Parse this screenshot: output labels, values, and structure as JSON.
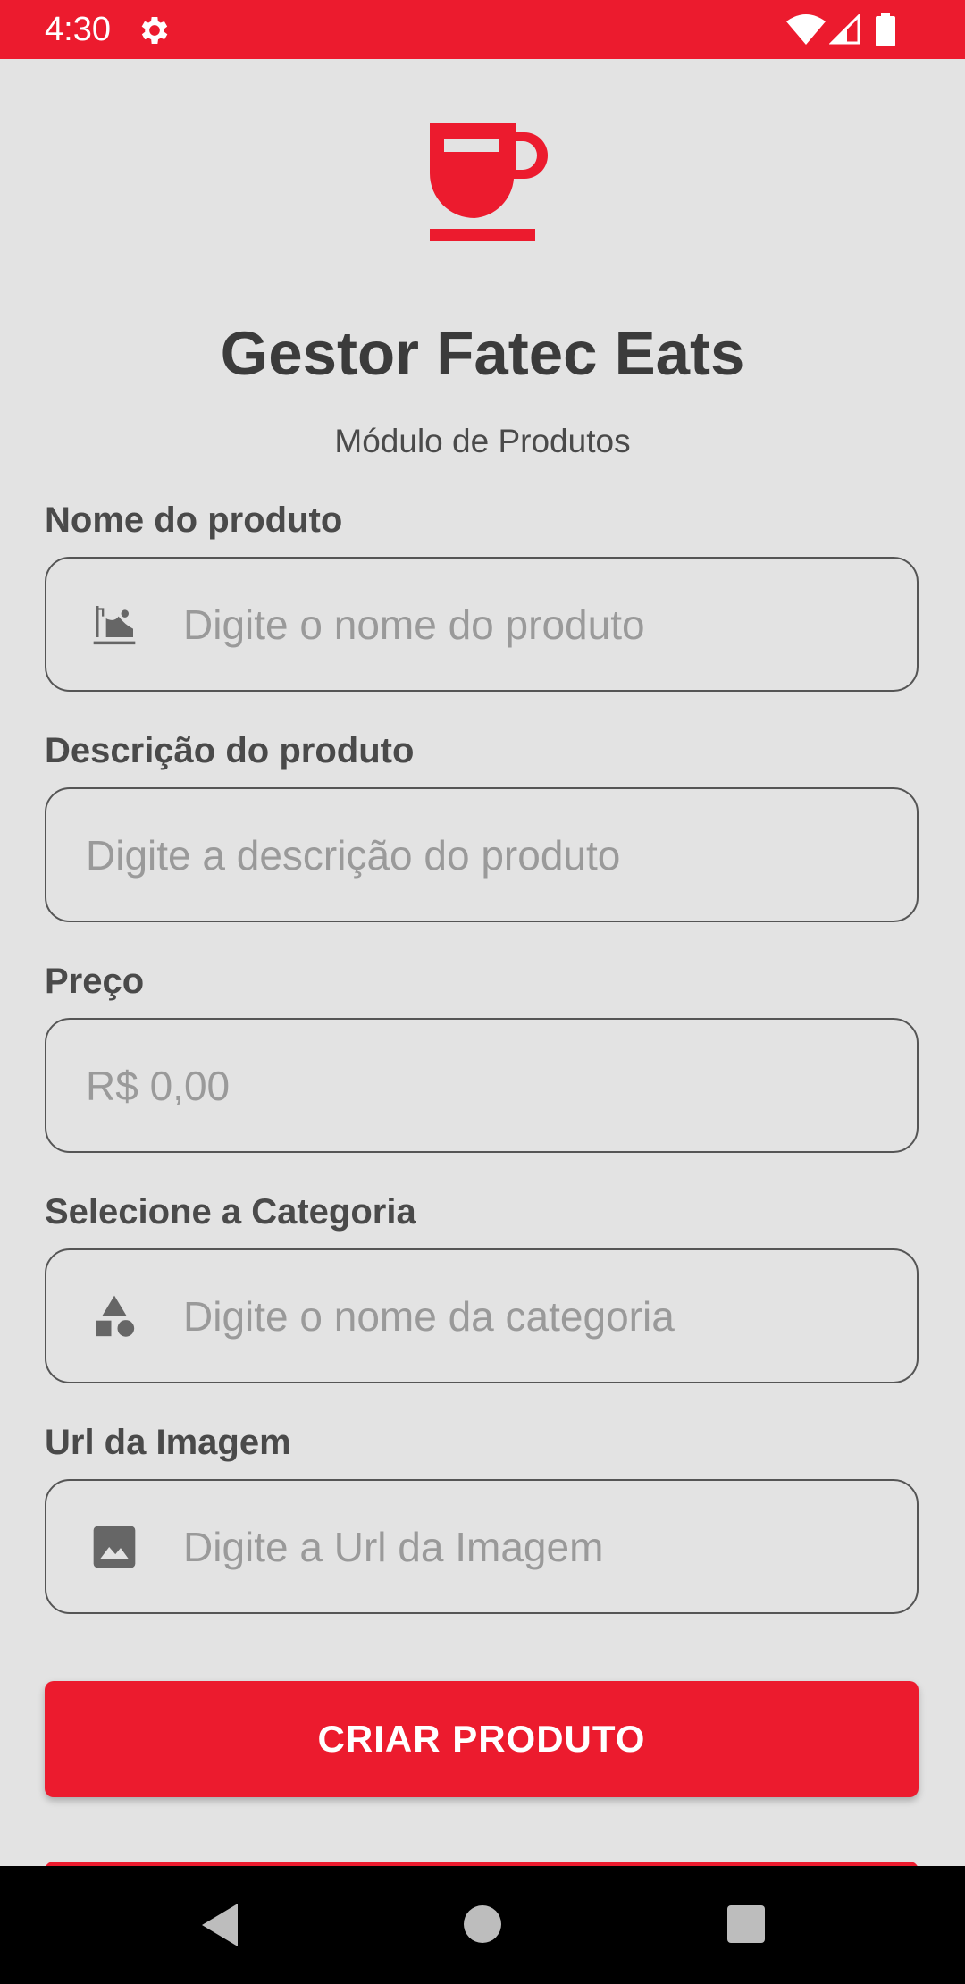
{
  "status_bar": {
    "time": "4:30",
    "icons": [
      "gear-icon",
      "wifi-icon",
      "signal-icon",
      "battery-icon"
    ]
  },
  "header": {
    "logo_icon": "coffee-cup-icon",
    "title": "Gestor Fatec Eats",
    "subtitle": "Módulo de Produtos"
  },
  "form": {
    "product_name": {
      "label": "Nome do produto",
      "placeholder": "Digite o nome do produto",
      "icon": "food-tray-icon"
    },
    "description": {
      "label": "Descrição do produto",
      "placeholder": "Digite a descrição do produto"
    },
    "price": {
      "label": "Preço",
      "placeholder": "R$ 0,00"
    },
    "category": {
      "label": "Selecione a Categoria",
      "placeholder": "Digite o nome da categoria",
      "icon": "category-shapes-icon"
    },
    "image_url": {
      "label": "Url da Imagem",
      "placeholder": "Digite a Url da Imagem",
      "icon": "image-icon"
    },
    "submit_label": "CRIAR PRODUTO"
  },
  "colors": {
    "primary": "#ec1b2e",
    "background": "#e3e3e3",
    "text": "#3a3a3a",
    "placeholder": "#9a9a9a"
  },
  "nav_bar": {
    "icons": [
      "back-icon",
      "home-icon",
      "recents-icon"
    ]
  }
}
